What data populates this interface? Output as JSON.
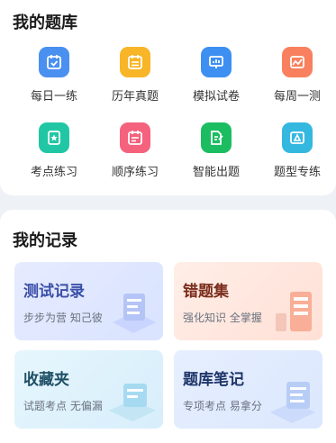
{
  "bank": {
    "title": "我的题库",
    "tools": [
      {
        "label": "每日一练",
        "icon": "calendar-check-icon",
        "color": "#4a90f0"
      },
      {
        "label": "历年真题",
        "icon": "calendar-list-icon",
        "color": "#f7b527"
      },
      {
        "label": "模拟试卷",
        "icon": "bar-chart-board-icon",
        "color": "#3d8ff2"
      },
      {
        "label": "每周一测",
        "icon": "image-chart-icon",
        "color": "#f9805f"
      },
      {
        "label": "考点练习",
        "icon": "star-note-icon",
        "color": "#21c7a4"
      },
      {
        "label": "顺序练习",
        "icon": "calendar-ordered-icon",
        "color": "#f4627d"
      },
      {
        "label": "智能出题",
        "icon": "document-edit-icon",
        "color": "#1cbd61"
      },
      {
        "label": "题型专练",
        "icon": "triangle-board-icon",
        "color": "#35b8e0"
      }
    ]
  },
  "records": {
    "title": "我的记录",
    "cards": [
      {
        "title": "测试记录",
        "subtitle": "步步为营 知己彼",
        "title_color": "#3a4fa8",
        "bg_from": "#e6ebff",
        "bg_to": "#d9e3ff"
      },
      {
        "title": "错题集",
        "subtitle": "强化知识 全掌握",
        "title_color": "#7a2d1c",
        "bg_from": "#ffeee7",
        "bg_to": "#ffe0d6"
      },
      {
        "title": "收藏夹",
        "subtitle": "试题考点 无偏漏",
        "title_color": "#1f4f66",
        "bg_from": "#e6f6fd",
        "bg_to": "#d7eefb"
      },
      {
        "title": "题库笔记",
        "subtitle": "专项考点 易拿分",
        "title_color": "#1f3569",
        "bg_from": "#e6efff",
        "bg_to": "#dbe7fd"
      }
    ]
  }
}
